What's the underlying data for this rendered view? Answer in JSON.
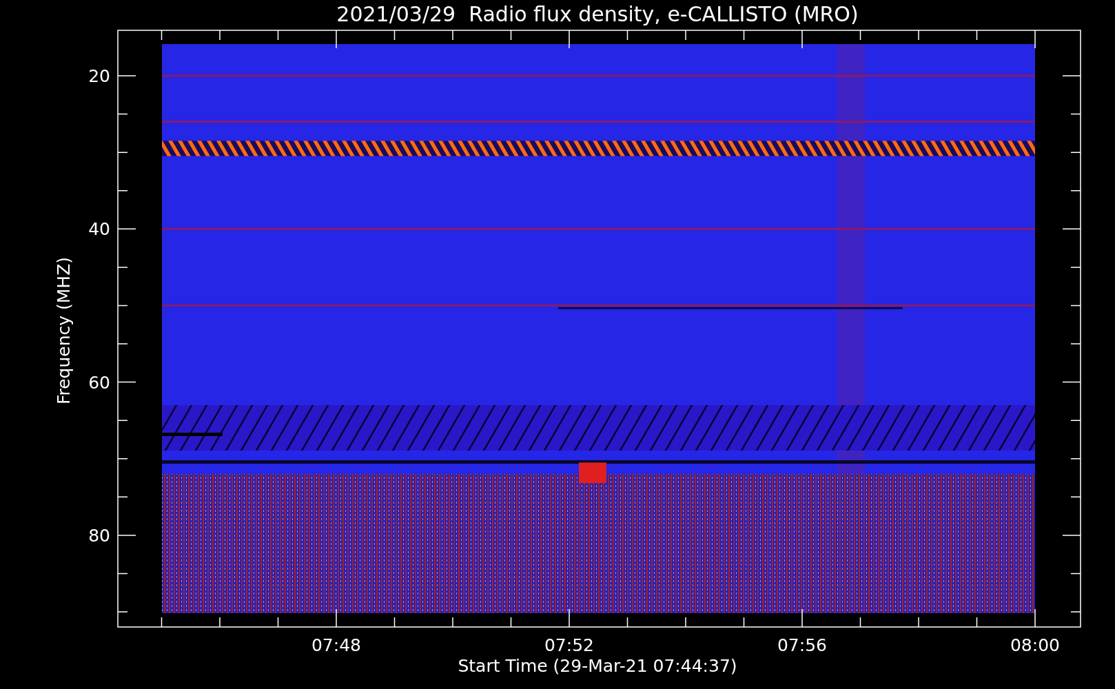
{
  "title": "2021/03/29  Radio flux density, e-CALLISTO (MRO)",
  "y_axis": {
    "label": "Frequency (MHZ)",
    "ticks": [
      "20",
      "40",
      "60",
      "80"
    ]
  },
  "x_axis": {
    "label": "Start Time (29-Mar-21 07:44:37)",
    "ticks": [
      "07:48",
      "07:52",
      "07:56",
      "08:00"
    ]
  }
}
